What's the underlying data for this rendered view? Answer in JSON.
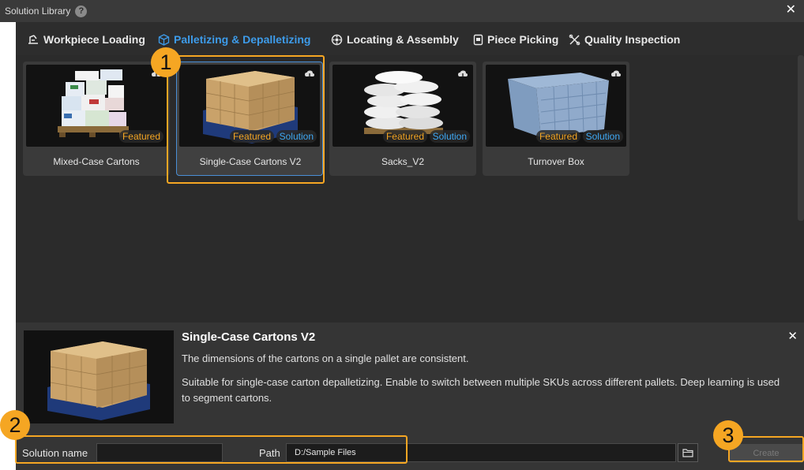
{
  "window": {
    "title": "Solution Library",
    "help": "?",
    "close": "✕"
  },
  "tabs": [
    {
      "label": "Workpiece Loading",
      "icon": "loading-icon"
    },
    {
      "label": "Palletizing & Depalletizing",
      "icon": "box-icon",
      "active": true
    },
    {
      "label": "Locating & Assembly",
      "icon": "gear-icon"
    },
    {
      "label": "Piece Picking",
      "icon": "piece-icon"
    },
    {
      "label": "Quality Inspection",
      "icon": "inspection-icon"
    }
  ],
  "cards": [
    {
      "name": "Mixed-Case Cartons",
      "badges": [
        "Featured"
      ]
    },
    {
      "name": "Single-Case Cartons V2",
      "badges": [
        "Featured",
        "Solution"
      ],
      "selected": true
    },
    {
      "name": "Sacks_V2",
      "badges": [
        "Featured",
        "Solution"
      ]
    },
    {
      "name": "Turnover Box",
      "badges": [
        "Featured",
        "Solution"
      ]
    }
  ],
  "details": {
    "title": "Single-Case Cartons V2",
    "description": "The dimensions of the cartons on a single pallet are consistent.",
    "long": "Suitable for single-case carton depalletizing. Enable to switch between multiple SKUs across different pallets. Deep learning is used to segment cartons.",
    "close": "✕"
  },
  "form": {
    "name_label": "Solution name",
    "name_value": "",
    "path_label": "Path",
    "path_value": "D:/Sample Files",
    "create_label": "Create"
  },
  "markers": [
    "1",
    "2",
    "3"
  ],
  "colors": {
    "accent": "#f5a623",
    "active_tab": "#3d9be9",
    "solution_badge": "#3fa9f5"
  }
}
